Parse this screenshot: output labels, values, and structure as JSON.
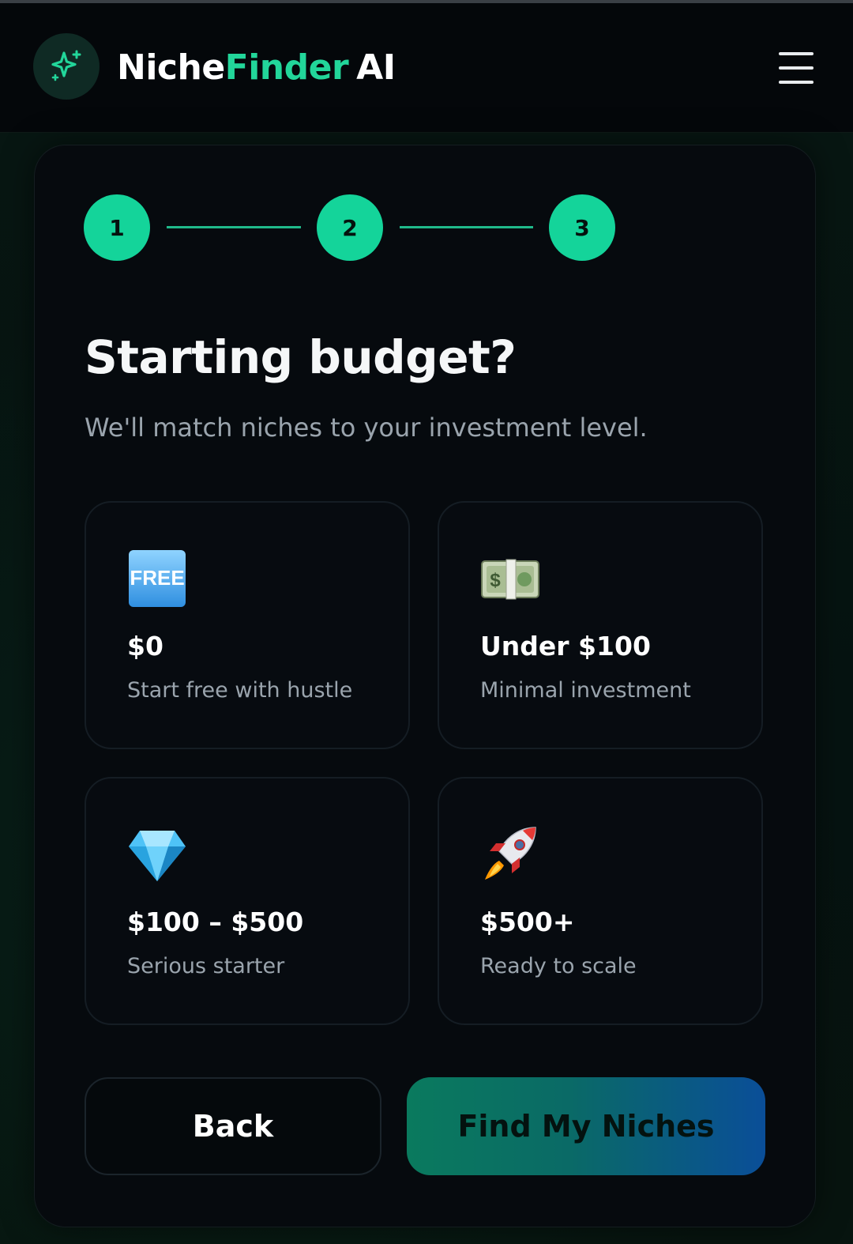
{
  "header": {
    "brand_part1": "Niche",
    "brand_part2": "Finder",
    "brand_part3": "AI",
    "accent_color": "#22d69a"
  },
  "steps": [
    {
      "number": "1"
    },
    {
      "number": "2"
    },
    {
      "number": "3"
    }
  ],
  "question": {
    "title": "Starting budget?",
    "subtitle": "We'll match niches to your investment level."
  },
  "options": [
    {
      "icon": "free-badge-icon",
      "label": "$0",
      "description": "Start free with hustle"
    },
    {
      "icon": "dollar-banknote-icon",
      "label": "Under $100",
      "description": "Minimal investment"
    },
    {
      "icon": "gem-icon",
      "label": "$100 – $500",
      "description": "Serious starter"
    },
    {
      "icon": "rocket-icon",
      "label": "$500+",
      "description": "Ready to scale"
    }
  ],
  "actions": {
    "back_label": "Back",
    "submit_label": "Find My Niches"
  }
}
